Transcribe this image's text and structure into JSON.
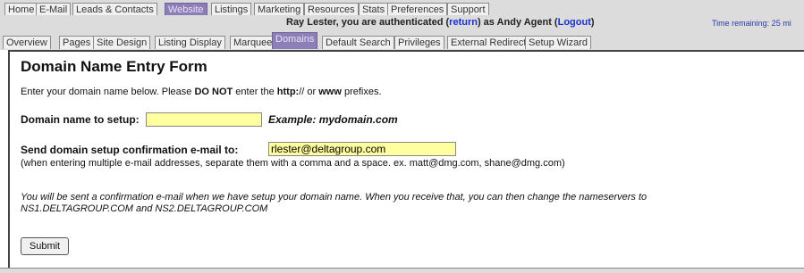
{
  "top_nav": [
    "Home",
    "E-Mail",
    "Leads & Contacts",
    "Website",
    "Listings",
    "Marketing",
    "Resources",
    "Stats",
    "Preferences",
    "Support"
  ],
  "top_nav_active": "Website",
  "auth": {
    "prefix": "Ray Lester, you are authenticated (",
    "return_link": "return",
    "middle": ") as Andy Agent (",
    "logout_link": "Logout",
    "suffix": ")"
  },
  "timer": "Time remaining:  25 mi",
  "sub_nav": [
    "Overview",
    "Pages",
    "Site Design",
    "Listing Display",
    "Marquee",
    "Domains",
    "Default Search",
    "Privileges",
    "External Redirect",
    "Setup Wizard"
  ],
  "sub_nav_active": "Domains",
  "form": {
    "title": "Domain Name Entry Form",
    "intro_1": "Enter your domain name below. Please ",
    "intro_do_not": "DO NOT",
    "intro_2": " enter the ",
    "intro_http": "http:",
    "intro_3": "// or ",
    "intro_www": "www",
    "intro_4": " prefixes.",
    "domain_label": "Domain name to setup:",
    "domain_value": "",
    "domain_example": "Example: mydomain.com",
    "email_label": "Send domain setup confirmation e-mail to:",
    "email_value": "rlester@deltagroup.com",
    "email_note": "(when entering multiple e-mail addresses, separate them with a comma and a space. ex. matt@dmg.com, shane@dmg.com)",
    "confirm_line1": "You will be sent a confirmation e-mail when we have setup your domain name. When you receive that, you can then change the nameservers to",
    "confirm_line2": "NS1.DELTAGROUP.COM and NS2.DELTAGROUP.COM",
    "submit_label": "Submit"
  }
}
